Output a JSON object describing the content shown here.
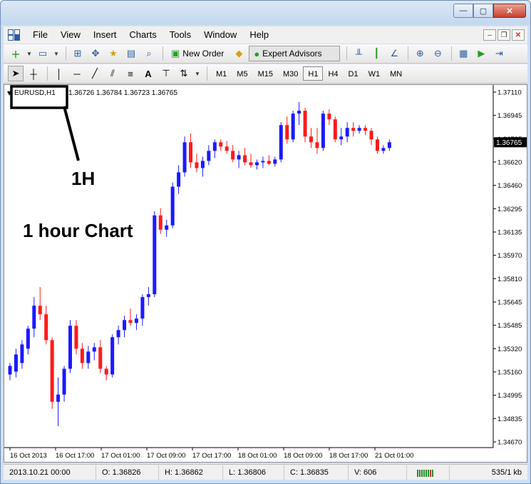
{
  "window": {
    "controls": {
      "minimize": "—",
      "maximize": "▢",
      "close": "✕"
    }
  },
  "menu": {
    "items": [
      "File",
      "View",
      "Insert",
      "Charts",
      "Tools",
      "Window",
      "Help"
    ],
    "mdi": {
      "minimize": "–",
      "restore": "❐",
      "close": "✕"
    }
  },
  "toolbar": {
    "new_order": "New Order",
    "expert_advisors": "Expert Advisors",
    "timeframes": [
      "M1",
      "M5",
      "M15",
      "M30",
      "H1",
      "H4",
      "D1",
      "W1",
      "MN"
    ],
    "active_timeframe": "H1"
  },
  "chart": {
    "symbol_label": "EURUSD,H1",
    "ohlc_label": "1.36726 1.36784 1.36723 1.36765",
    "current_price_label": "1.36765",
    "annotation_box_text": "1H",
    "annotation_text": "1 hour Chart",
    "colors": {
      "bull": "#1a1aff",
      "bear": "#ff1a1a",
      "grid": "#000000",
      "price_tag_bg": "#000000"
    }
  },
  "chart_data": {
    "type": "candlestick",
    "y_ticks": [
      "1.37110",
      "1.36945",
      "1.36785",
      "1.36620",
      "1.36460",
      "1.36295",
      "1.36135",
      "1.35970",
      "1.35810",
      "1.35645",
      "1.35485",
      "1.35320",
      "1.35160",
      "1.34995",
      "1.34835",
      "1.34670"
    ],
    "ylim": [
      1.3467,
      1.3711
    ],
    "x_ticks": [
      "16 Oct 2013",
      "16 Oct 17:00",
      "17 Oct 01:00",
      "17 Oct 09:00",
      "17 Oct 17:00",
      "18 Oct 01:00",
      "18 Oct 09:00",
      "18 Oct 17:00",
      "21 Oct 01:00"
    ],
    "candles": [
      [
        1.3514,
        1.3522,
        1.351,
        1.352
      ],
      [
        1.3516,
        1.3532,
        1.3512,
        1.3528
      ],
      [
        1.3522,
        1.3538,
        1.3518,
        1.3535
      ],
      [
        1.3532,
        1.3548,
        1.3528,
        1.3546
      ],
      [
        1.3546,
        1.3568,
        1.354,
        1.3562
      ],
      [
        1.3562,
        1.3575,
        1.3552,
        1.3556
      ],
      [
        1.3556,
        1.3562,
        1.3535,
        1.3538
      ],
      [
        1.3538,
        1.354,
        1.349,
        1.3495
      ],
      [
        1.3495,
        1.3512,
        1.3478,
        1.35
      ],
      [
        1.35,
        1.352,
        1.3495,
        1.3518
      ],
      [
        1.3518,
        1.3552,
        1.3515,
        1.3548
      ],
      [
        1.3548,
        1.3552,
        1.3528,
        1.3532
      ],
      [
        1.3532,
        1.3536,
        1.3518,
        1.3522
      ],
      [
        1.3522,
        1.3534,
        1.3518,
        1.353
      ],
      [
        1.353,
        1.3536,
        1.3524,
        1.3533
      ],
      [
        1.3533,
        1.3538,
        1.3515,
        1.3518
      ],
      [
        1.3518,
        1.352,
        1.351,
        1.3514
      ],
      [
        1.3514,
        1.3542,
        1.3512,
        1.354
      ],
      [
        1.354,
        1.3548,
        1.3535,
        1.3545
      ],
      [
        1.3545,
        1.3555,
        1.354,
        1.3552
      ],
      [
        1.3552,
        1.356,
        1.3548,
        1.355
      ],
      [
        1.355,
        1.3556,
        1.3545,
        1.3553
      ],
      [
        1.3553,
        1.357,
        1.3548,
        1.3568
      ],
      [
        1.3568,
        1.3575,
        1.3562,
        1.357
      ],
      [
        1.357,
        1.3628,
        1.3568,
        1.3625
      ],
      [
        1.3625,
        1.363,
        1.3612,
        1.3615
      ],
      [
        1.3615,
        1.3622,
        1.361,
        1.3618
      ],
      [
        1.3618,
        1.3648,
        1.3616,
        1.3645
      ],
      [
        1.3645,
        1.366,
        1.364,
        1.3655
      ],
      [
        1.3655,
        1.368,
        1.3652,
        1.3676
      ],
      [
        1.3676,
        1.3682,
        1.3658,
        1.3662
      ],
      [
        1.3662,
        1.3668,
        1.3655,
        1.3658
      ],
      [
        1.3658,
        1.3666,
        1.3652,
        1.3663
      ],
      [
        1.3663,
        1.3674,
        1.366,
        1.367
      ],
      [
        1.367,
        1.3678,
        1.3665,
        1.3676
      ],
      [
        1.3676,
        1.3678,
        1.367,
        1.3673
      ],
      [
        1.3673,
        1.3677,
        1.3668,
        1.367
      ],
      [
        1.367,
        1.3674,
        1.3662,
        1.3664
      ],
      [
        1.3664,
        1.367,
        1.3658,
        1.3667
      ],
      [
        1.3667,
        1.3672,
        1.366,
        1.3662
      ],
      [
        1.3662,
        1.3668,
        1.3658,
        1.366
      ],
      [
        1.366,
        1.3664,
        1.3657,
        1.3662
      ],
      [
        1.3662,
        1.3666,
        1.3658,
        1.3663
      ],
      [
        1.3663,
        1.3667,
        1.366,
        1.3661
      ],
      [
        1.3661,
        1.3666,
        1.3659,
        1.3664
      ],
      [
        1.3664,
        1.369,
        1.3662,
        1.3688
      ],
      [
        1.3688,
        1.3694,
        1.3675,
        1.3678
      ],
      [
        1.3678,
        1.3698,
        1.3676,
        1.3696
      ],
      [
        1.3696,
        1.3704,
        1.3688,
        1.3698
      ],
      [
        1.3698,
        1.37,
        1.3676,
        1.368
      ],
      [
        1.368,
        1.3686,
        1.3672,
        1.3676
      ],
      [
        1.3676,
        1.3686,
        1.3668,
        1.3672
      ],
      [
        1.3672,
        1.3698,
        1.367,
        1.3696
      ],
      [
        1.3696,
        1.3699,
        1.3688,
        1.3692
      ],
      [
        1.3692,
        1.3694,
        1.3676,
        1.3678
      ],
      [
        1.3678,
        1.3686,
        1.3674,
        1.368
      ],
      [
        1.368,
        1.369,
        1.3676,
        1.3686
      ],
      [
        1.3686,
        1.369,
        1.368,
        1.3684
      ],
      [
        1.3684,
        1.3688,
        1.3682,
        1.3686
      ],
      [
        1.3686,
        1.3688,
        1.3681,
        1.3684
      ],
      [
        1.3684,
        1.3686,
        1.3674,
        1.3678
      ],
      [
        1.3678,
        1.368,
        1.3668,
        1.367
      ],
      [
        1.367,
        1.3674,
        1.3668,
        1.3672
      ],
      [
        1.3672,
        1.3678,
        1.367,
        1.3676
      ]
    ]
  },
  "status": {
    "datetime": "2013.10.21 00:00",
    "open": "O: 1.36826",
    "high": "H: 1.36862",
    "low": "L: 1.36806",
    "close": "C: 1.36835",
    "volume": "V: 606",
    "traffic": "535/1 kb"
  }
}
